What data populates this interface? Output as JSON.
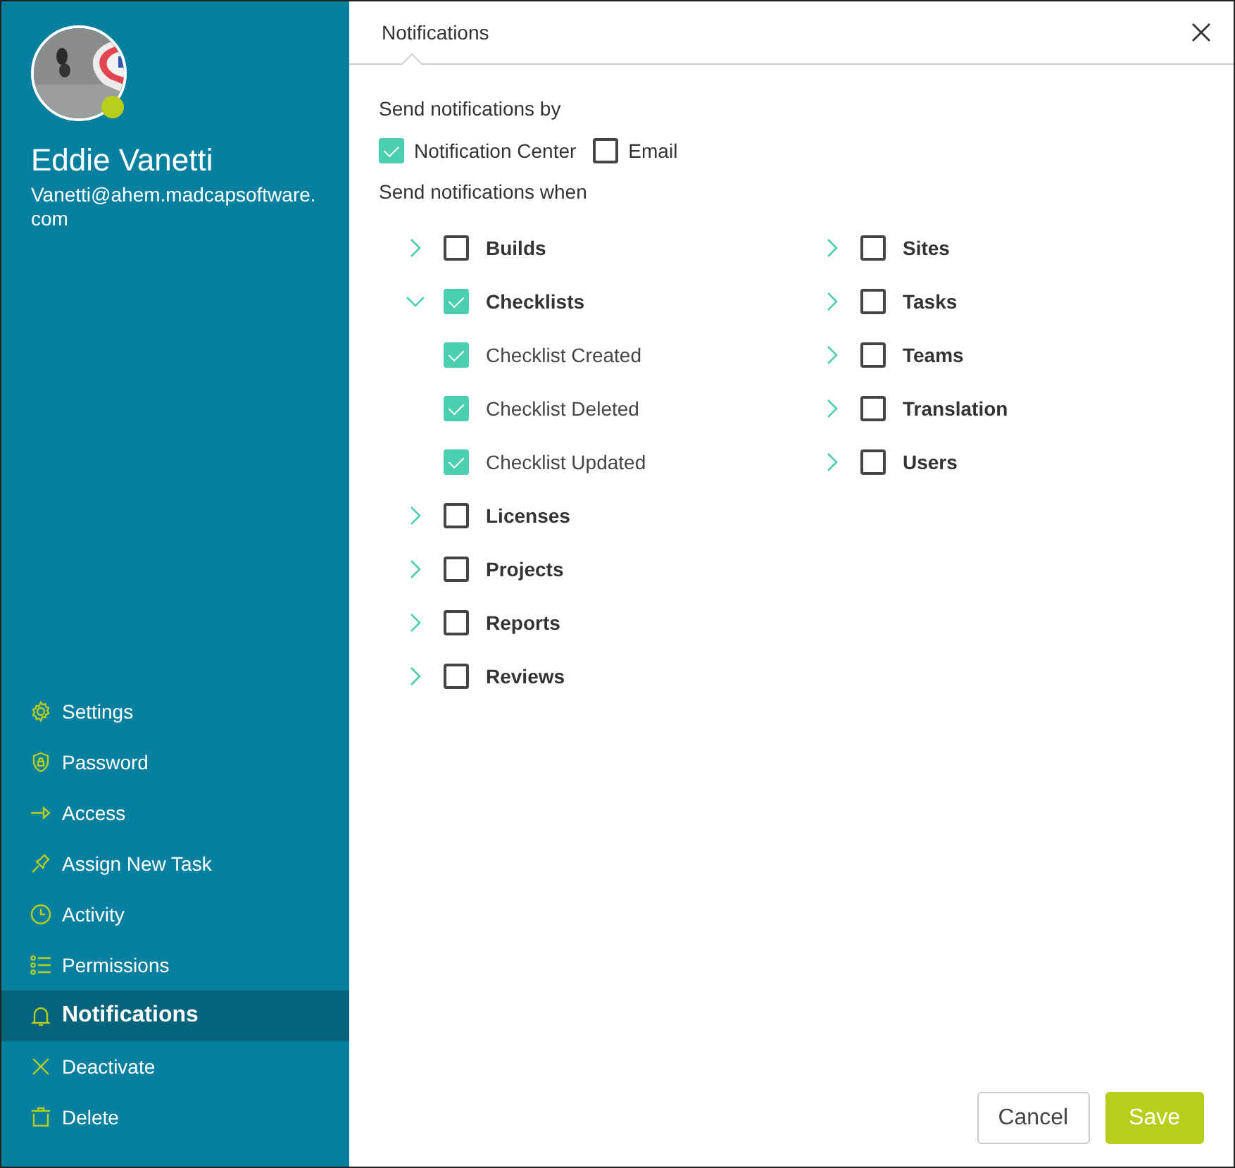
{
  "user": {
    "name": "Eddie Vanetti",
    "email": "Vanetti@ahem.madcapsoftware.com",
    "online": true
  },
  "sidebar": {
    "items": [
      {
        "label": "Settings",
        "selected": false
      },
      {
        "label": "Password",
        "selected": false
      },
      {
        "label": "Access",
        "selected": false
      },
      {
        "label": "Assign New Task",
        "selected": false
      },
      {
        "label": "Activity",
        "selected": false
      },
      {
        "label": "Permissions",
        "selected": false
      },
      {
        "label": "Notifications",
        "selected": true
      },
      {
        "label": "Deactivate",
        "selected": false
      },
      {
        "label": "Delete",
        "selected": false
      }
    ]
  },
  "panel": {
    "tab": "Notifications",
    "by_label": "Send notifications by",
    "channels": [
      {
        "label": "Notification Center",
        "checked": true
      },
      {
        "label": "Email",
        "checked": false
      }
    ],
    "when_label": "Send notifications when",
    "columns": [
      [
        {
          "label": "Builds",
          "checked": false,
          "expanded": false
        },
        {
          "label": "Checklists",
          "checked": true,
          "expanded": true,
          "children": [
            {
              "label": "Checklist Created",
              "checked": true
            },
            {
              "label": "Checklist Deleted",
              "checked": true
            },
            {
              "label": "Checklist Updated",
              "checked": true
            }
          ]
        },
        {
          "label": "Licenses",
          "checked": false,
          "expanded": false
        },
        {
          "label": "Projects",
          "checked": false,
          "expanded": false
        },
        {
          "label": "Reports",
          "checked": false,
          "expanded": false
        },
        {
          "label": "Reviews",
          "checked": false,
          "expanded": false
        }
      ],
      [
        {
          "label": "Sites",
          "checked": false,
          "expanded": false
        },
        {
          "label": "Tasks",
          "checked": false,
          "expanded": false
        },
        {
          "label": "Teams",
          "checked": false,
          "expanded": false
        },
        {
          "label": "Translation",
          "checked": false,
          "expanded": false
        },
        {
          "label": "Users",
          "checked": false,
          "expanded": false
        }
      ]
    ],
    "buttons": [
      {
        "label": "Cancel",
        "kind": "secondary"
      },
      {
        "label": "Save",
        "kind": "primary"
      }
    ]
  }
}
